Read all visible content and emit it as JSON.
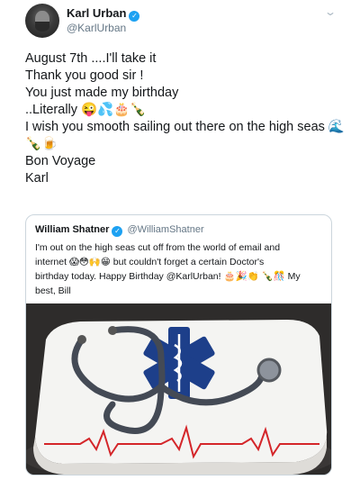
{
  "tweet": {
    "display_name": "Karl Urban",
    "handle": "@KarlUrban",
    "verified": true,
    "lines": [
      "August 7th ....I'll take it",
      "Thank you good sir !",
      "You just made my birthday",
      "..Literally 😜💦🎂🍾",
      "I wish you smooth sailing out there on the high seas 🌊",
      "🍾🍺",
      "Bon Voyage",
      "Karl"
    ]
  },
  "quoted_tweet": {
    "display_name": "William Shatner",
    "handle": "@WilliamShatner",
    "verified": true,
    "lines": [
      "I'm out on the high seas cut off from the world of email and",
      "internet 😱😳🙌😁 but couldn't forget a certain Doctor's",
      "birthday today. Happy Birthday @KarlUrban! 🎂🎉👏 🍾🎊 My",
      "best, Bill"
    ]
  },
  "icons": {
    "verified": "verified-badge-icon",
    "menu": "chevron-down-icon"
  },
  "colors": {
    "accent": "#1da1f2",
    "text": "#14171a",
    "muted": "#657786",
    "border": "#ccd6dd"
  }
}
